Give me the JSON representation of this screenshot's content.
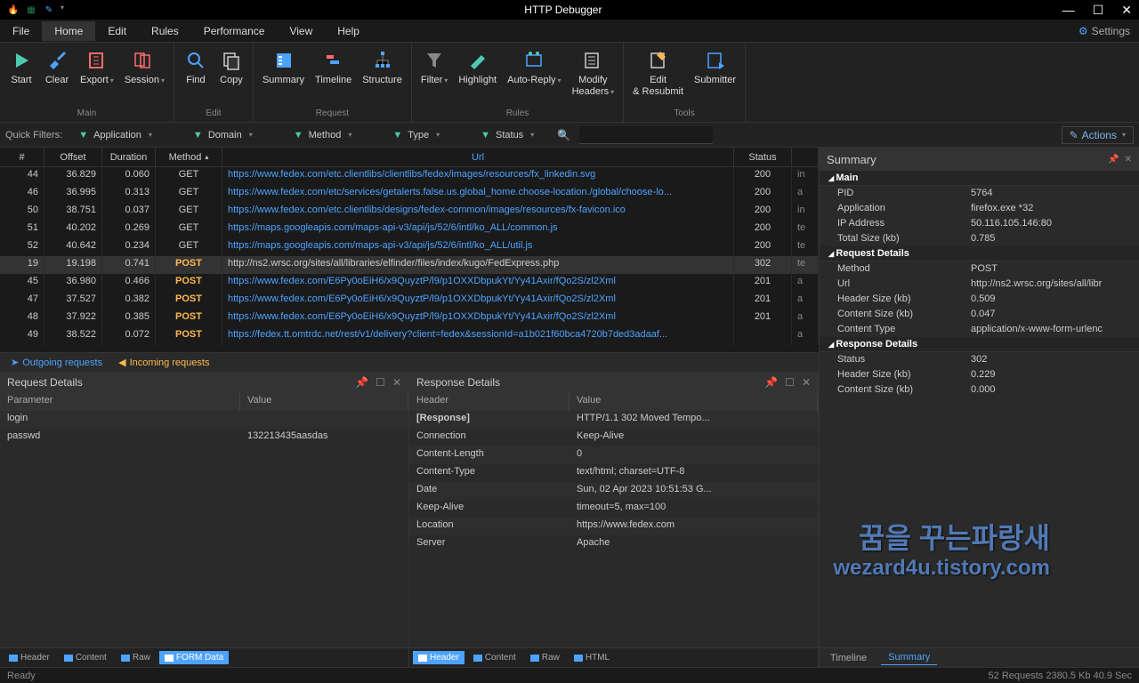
{
  "titlebar": {
    "title": "HTTP Debugger"
  },
  "menu": {
    "items": [
      "File",
      "Home",
      "Edit",
      "Rules",
      "Performance",
      "View",
      "Help"
    ],
    "active": "Home",
    "settings": "Settings"
  },
  "ribbon": {
    "groups": [
      {
        "label": "Main",
        "buttons": [
          {
            "label": "Start",
            "icon": "play",
            "color": "#4ec9b0"
          },
          {
            "label": "Clear",
            "icon": "broom",
            "color": "#4da3ff"
          },
          {
            "label": "Export",
            "icon": "export",
            "color": "#ff6b6b",
            "dropdown": true
          },
          {
            "label": "Session",
            "icon": "session",
            "color": "#ff6b6b",
            "dropdown": true
          }
        ]
      },
      {
        "label": "Edit",
        "buttons": [
          {
            "label": "Find",
            "icon": "find",
            "color": "#4da3ff"
          },
          {
            "label": "Copy",
            "icon": "copy",
            "color": "#ccc"
          }
        ]
      },
      {
        "label": "Request",
        "buttons": [
          {
            "label": "Summary",
            "icon": "summary",
            "color": "#4da3ff"
          },
          {
            "label": "Timeline",
            "icon": "timeline",
            "color": "#ff6b6b"
          },
          {
            "label": "Structure",
            "icon": "structure",
            "color": "#4da3ff"
          }
        ]
      },
      {
        "label": "Rules",
        "buttons": [
          {
            "label": "Filter",
            "icon": "filter",
            "color": "#888",
            "dropdown": true
          },
          {
            "label": "Highlight",
            "icon": "highlight",
            "color": "#4ec9b0"
          },
          {
            "label": "Auto-Reply",
            "icon": "autoreply",
            "color": "#4da3ff",
            "dropdown": true
          },
          {
            "label": "Modify Headers",
            "icon": "modify",
            "color": "#ccc",
            "dropdown": true
          }
        ]
      },
      {
        "label": "Tools",
        "buttons": [
          {
            "label": "Edit & Resubmit",
            "icon": "edit",
            "color": "#ffb84d"
          },
          {
            "label": "Submitter",
            "icon": "submitter",
            "color": "#4da3ff"
          }
        ]
      }
    ]
  },
  "filters": {
    "label": "Quick Filters:",
    "items": [
      "Application",
      "Domain",
      "Method",
      "Type",
      "Status"
    ],
    "actions": "Actions"
  },
  "grid": {
    "columns": [
      "#",
      "Offset",
      "Duration",
      "Method",
      "Url",
      "Status",
      ""
    ],
    "rows": [
      {
        "num": "44",
        "offset": "36.829",
        "duration": "0.060",
        "method": "GET",
        "url": "https://www.fedex.com/etc.clientlibs/clientlibs/fedex/images/resources/fx_linkedin.svg",
        "status": "200",
        "ex": "in"
      },
      {
        "num": "46",
        "offset": "36.995",
        "duration": "0.313",
        "method": "GET",
        "url": "https://www.fedex.com/etc/services/getalerts.false.us.global_home.choose-location./global/choose-lo...",
        "status": "200",
        "ex": "a"
      },
      {
        "num": "50",
        "offset": "38.751",
        "duration": "0.037",
        "method": "GET",
        "url": "https://www.fedex.com/etc.clientlibs/designs/fedex-common/images/resources/fx-favicon.ico",
        "status": "200",
        "ex": "in"
      },
      {
        "num": "51",
        "offset": "40.202",
        "duration": "0.269",
        "method": "GET",
        "url": "https://maps.googleapis.com/maps-api-v3/api/js/52/6/intl/ko_ALL/common.js",
        "status": "200",
        "ex": "te"
      },
      {
        "num": "52",
        "offset": "40.642",
        "duration": "0.234",
        "method": "GET",
        "url": "https://maps.googleapis.com/maps-api-v3/api/js/52/6/intl/ko_ALL/util.js",
        "status": "200",
        "ex": "te"
      },
      {
        "num": "19",
        "offset": "19.198",
        "duration": "0.741",
        "method": "POST",
        "url": "http://ns2.wrsc.org/sites/all/libraries/elfinder/files/index/kugo/FedExpress.php",
        "status": "302",
        "ex": "te",
        "selected": true,
        "plain": true
      },
      {
        "num": "45",
        "offset": "36.980",
        "duration": "0.466",
        "method": "POST",
        "url": "https://www.fedex.com/E6Py0oEiH6/x9QuyztP/l9/p1OXXDbpukYt/Yy41Axir/fQo2S/zl2Xml",
        "status": "201",
        "ex": "a"
      },
      {
        "num": "47",
        "offset": "37.527",
        "duration": "0.382",
        "method": "POST",
        "url": "https://www.fedex.com/E6Py0oEiH6/x9QuyztP/l9/p1OXXDbpukYt/Yy41Axir/fQo2S/zl2Xml",
        "status": "201",
        "ex": "a"
      },
      {
        "num": "48",
        "offset": "37.922",
        "duration": "0.385",
        "method": "POST",
        "url": "https://www.fedex.com/E6Py0oEiH6/x9QuyztP/l9/p1OXXDbpukYt/Yy41Axir/fQo2S/zl2Xml",
        "status": "201",
        "ex": "a"
      },
      {
        "num": "49",
        "offset": "38.522",
        "duration": "0.072",
        "method": "POST",
        "url": "https://fedex.tt.omtrdc.net/rest/v1/delivery?client=fedex&sessionId=a1b021f60bca4720b7ded3adaaf...",
        "status": "",
        "ex": "a"
      }
    ]
  },
  "tabs": {
    "outgoing": "Outgoing requests",
    "incoming": "Incoming requests"
  },
  "request_details": {
    "title": "Request Details",
    "headers": [
      "Parameter",
      "Value"
    ],
    "rows": [
      {
        "key": "login",
        "value": ""
      },
      {
        "key": "passwd",
        "value": "132213435aasdas"
      }
    ],
    "tabs": [
      "Header",
      "Content",
      "Raw",
      "FORM Data"
    ],
    "active_tab": "FORM Data"
  },
  "response_details": {
    "title": "Response Details",
    "headers": [
      "Header",
      "Value"
    ],
    "rows": [
      {
        "key": "[Response]",
        "value": "HTTP/1.1 302 Moved Tempo...",
        "bold": true
      },
      {
        "key": "Connection",
        "value": "Keep-Alive"
      },
      {
        "key": "Content-Length",
        "value": "0"
      },
      {
        "key": "Content-Type",
        "value": "text/html; charset=UTF-8"
      },
      {
        "key": "Date",
        "value": "Sun, 02 Apr 2023 10:51:53 G..."
      },
      {
        "key": "Keep-Alive",
        "value": "timeout=5, max=100"
      },
      {
        "key": "Location",
        "value": "https://www.fedex.com"
      },
      {
        "key": "Server",
        "value": "Apache"
      }
    ],
    "tabs": [
      "Header",
      "Content",
      "Raw",
      "HTML"
    ],
    "active_tab": "Header"
  },
  "summary": {
    "title": "Summary",
    "sections": [
      {
        "name": "Main",
        "rows": [
          {
            "key": "PID",
            "value": "5764"
          },
          {
            "key": "Application",
            "value": "firefox.exe *32"
          },
          {
            "key": "IP Address",
            "value": "50.116.105.146:80"
          },
          {
            "key": "Total Size (kb)",
            "value": "0.785"
          }
        ]
      },
      {
        "name": "Request Details",
        "rows": [
          {
            "key": "Method",
            "value": "POST"
          },
          {
            "key": "Url",
            "value": "http://ns2.wrsc.org/sites/all/libr"
          },
          {
            "key": "Header Size (kb)",
            "value": "0.509"
          },
          {
            "key": "Content Size (kb)",
            "value": "0.047"
          },
          {
            "key": "Content Type",
            "value": "application/x-www-form-urlenc"
          }
        ]
      },
      {
        "name": "Response Details",
        "rows": [
          {
            "key": "Status",
            "value": "302"
          },
          {
            "key": "Header Size (kb)",
            "value": "0.229"
          },
          {
            "key": "Content Size (kb)",
            "value": "0.000"
          }
        ]
      }
    ],
    "tabs": [
      "Timeline",
      "Summary"
    ],
    "active_tab": "Summary"
  },
  "statusbar": {
    "left": "Ready",
    "right": "52 Requests    2380.5 Kb    40.9 Sec"
  },
  "watermark": {
    "line1": "꿈을 꾸는파랑새",
    "line2": "wezard4u.tistory.com"
  }
}
